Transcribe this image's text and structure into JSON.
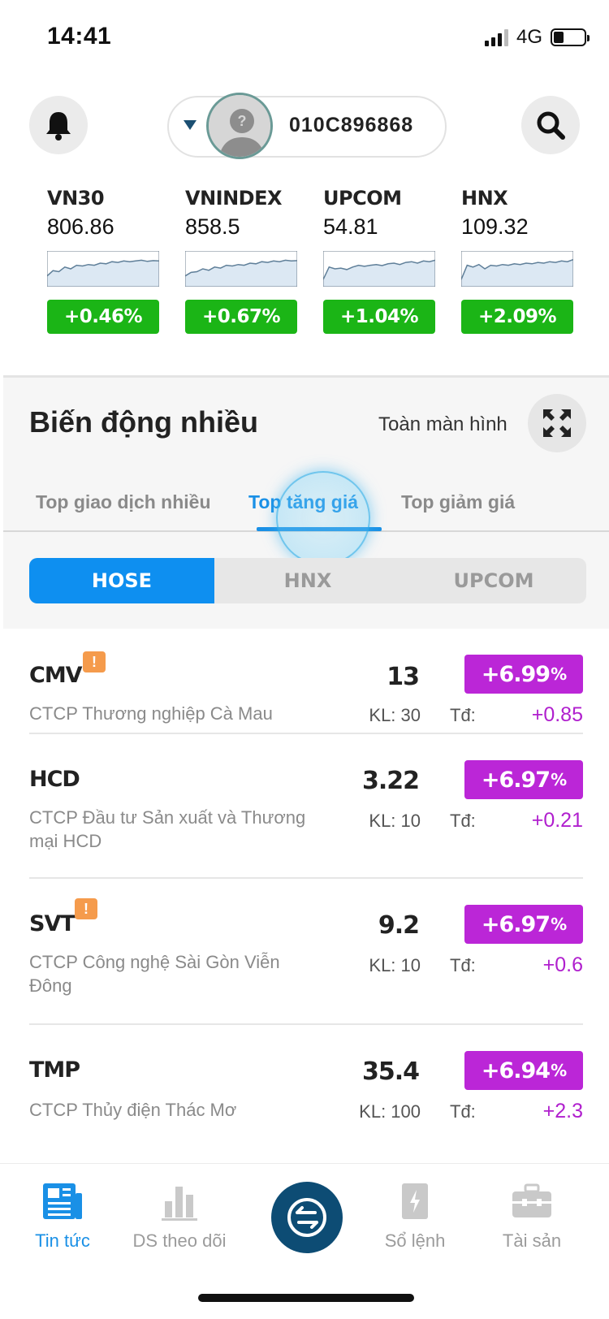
{
  "status_bar": {
    "time": "14:41",
    "network": "4G"
  },
  "header": {
    "account_number": "010C896868"
  },
  "indices": [
    {
      "name": "VN30",
      "value": "806.86",
      "change": "+0.46%",
      "trend": [
        0.3,
        0.45,
        0.42,
        0.55,
        0.5,
        0.6,
        0.58,
        0.62,
        0.6,
        0.66,
        0.64,
        0.7,
        0.68,
        0.72,
        0.7,
        0.72,
        0.74,
        0.71,
        0.73,
        0.72
      ]
    },
    {
      "name": "VNINDEX",
      "value": "858.5",
      "change": "+0.67%",
      "trend": [
        0.3,
        0.4,
        0.42,
        0.5,
        0.46,
        0.55,
        0.52,
        0.6,
        0.58,
        0.62,
        0.6,
        0.66,
        0.64,
        0.7,
        0.68,
        0.72,
        0.7,
        0.74,
        0.72,
        0.73
      ]
    },
    {
      "name": "UPCOM",
      "value": "54.81",
      "change": "+1.04%",
      "trend": [
        0.2,
        0.55,
        0.5,
        0.52,
        0.48,
        0.55,
        0.6,
        0.57,
        0.6,
        0.62,
        0.59,
        0.64,
        0.66,
        0.62,
        0.68,
        0.7,
        0.66,
        0.72,
        0.7,
        0.74
      ]
    },
    {
      "name": "HNX",
      "value": "109.32",
      "change": "+2.09%",
      "trend": [
        0.2,
        0.6,
        0.55,
        0.62,
        0.5,
        0.6,
        0.58,
        0.62,
        0.6,
        0.64,
        0.62,
        0.66,
        0.64,
        0.68,
        0.66,
        0.7,
        0.68,
        0.72,
        0.7,
        0.76
      ]
    }
  ],
  "colors": {
    "up_green": "#1bb516",
    "ceiling_purple": "#bb26d7",
    "accent_blue": "#1a90e6",
    "fab_navy": "#0d4c74"
  },
  "section": {
    "title": "Biến động nhiều",
    "fullscreen_label": "Toàn màn hình",
    "tabs": [
      "Top giao dịch nhiều",
      "Top tăng giá",
      "Top giảm giá"
    ],
    "active_tab": "Top tăng giá",
    "exchanges": [
      "HOSE",
      "HNX",
      "UPCOM"
    ],
    "active_exchange": "HOSE"
  },
  "stocks": [
    {
      "code": "CMV",
      "warning": true,
      "name": "CTCP Thương nghiệp Cà Mau",
      "price": "13",
      "volume": "KL: 30",
      "change_pct": "+6.99",
      "td_label": "Tđ:",
      "td_value": "+0.85"
    },
    {
      "code": "HCD",
      "warning": false,
      "name": "CTCP Đầu tư Sản xuất và Thương mại HCD",
      "price": "3.22",
      "volume": "KL: 10",
      "change_pct": "+6.97",
      "td_label": "Tđ:",
      "td_value": "+0.21"
    },
    {
      "code": "SVT",
      "warning": true,
      "name": "CTCP Công nghệ Sài Gòn Viễn Đông",
      "price": "9.2",
      "volume": "KL: 10",
      "change_pct": "+6.97",
      "td_label": "Tđ:",
      "td_value": "+0.6"
    },
    {
      "code": "TMP",
      "warning": false,
      "name": "CTCP Thủy điện Thác Mơ",
      "price": "35.4",
      "volume": "KL: 100",
      "change_pct": "+6.94",
      "td_label": "Tđ:",
      "td_value": "+2.3"
    }
  ],
  "percent_sign": "%",
  "warning_glyph": "!",
  "bottom_nav": {
    "items": [
      {
        "label": "Tin tức",
        "icon": "newspaper-icon"
      },
      {
        "label": "DS theo dõi",
        "icon": "bar-chart-icon"
      },
      {
        "label": "Sổ lệnh",
        "icon": "order-book-icon"
      },
      {
        "label": "Tài sản",
        "icon": "briefcase-icon"
      }
    ],
    "center_icon": "exchange-arrows-icon"
  }
}
